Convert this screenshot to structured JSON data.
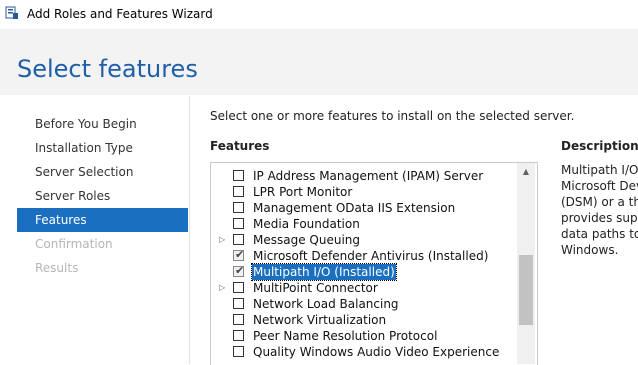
{
  "window": {
    "title": "Add Roles and Features Wizard"
  },
  "header": {
    "page_title": "Select features"
  },
  "nav": {
    "items": [
      {
        "label": "Before You Begin",
        "state": "normal"
      },
      {
        "label": "Installation Type",
        "state": "normal"
      },
      {
        "label": "Server Selection",
        "state": "normal"
      },
      {
        "label": "Server Roles",
        "state": "normal"
      },
      {
        "label": "Features",
        "state": "active"
      },
      {
        "label": "Confirmation",
        "state": "disabled"
      },
      {
        "label": "Results",
        "state": "disabled"
      }
    ]
  },
  "main": {
    "instruction": "Select one or more features to install on the selected server.",
    "features_heading": "Features",
    "features": [
      {
        "label": "IP Address Management (IPAM) Server",
        "checked": false,
        "expandable": false,
        "selected": false
      },
      {
        "label": "LPR Port Monitor",
        "checked": false,
        "expandable": false,
        "selected": false
      },
      {
        "label": "Management OData IIS Extension",
        "checked": false,
        "expandable": false,
        "selected": false
      },
      {
        "label": "Media Foundation",
        "checked": false,
        "expandable": false,
        "selected": false
      },
      {
        "label": "Message Queuing",
        "checked": false,
        "expandable": true,
        "selected": false
      },
      {
        "label": "Microsoft Defender Antivirus (Installed)",
        "checked": true,
        "expandable": false,
        "selected": false
      },
      {
        "label": "Multipath I/O (Installed)",
        "checked": true,
        "expandable": false,
        "selected": true
      },
      {
        "label": "MultiPoint Connector",
        "checked": false,
        "expandable": true,
        "selected": false
      },
      {
        "label": "Network Load Balancing",
        "checked": false,
        "expandable": false,
        "selected": false
      },
      {
        "label": "Network Virtualization",
        "checked": false,
        "expandable": false,
        "selected": false
      },
      {
        "label": "Peer Name Resolution Protocol",
        "checked": false,
        "expandable": false,
        "selected": false
      },
      {
        "label": "Quality Windows Audio Video Experience",
        "checked": false,
        "expandable": false,
        "selected": false
      }
    ]
  },
  "description": {
    "heading": "Description",
    "lines": [
      "Multipath I/O,",
      "Microsoft Devi",
      "(DSM) or a thir",
      "provides suppo",
      "data paths to a",
      "Windows."
    ]
  },
  "icons": {
    "window_icon": "server-manager-icon",
    "expander": "triangle-right-icon",
    "scroll_up": "arrow-up-icon"
  },
  "colors": {
    "accent": "#1a6fc0",
    "title_blue": "#1f5ea8",
    "header_bg": "#f3f3f3"
  }
}
